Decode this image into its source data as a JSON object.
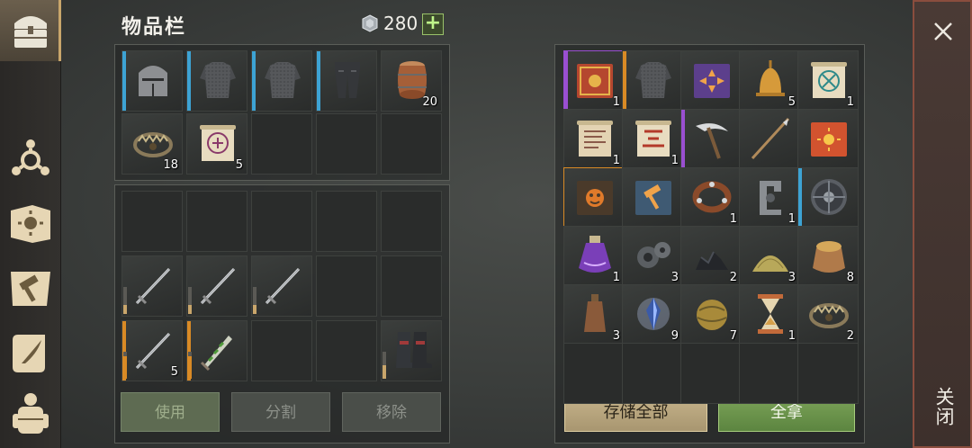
{
  "inventory": {
    "title": "物品栏",
    "currency_amount": "280",
    "add_label": "+",
    "rows": [
      [
        {
          "item": "knight-helmet",
          "rarity": "blue",
          "count": ""
        },
        {
          "item": "dark-chainmail-armor",
          "rarity": "blue",
          "count": ""
        },
        {
          "item": "dark-chainmail-armor",
          "rarity": "blue",
          "count": ""
        },
        {
          "item": "dark-leg-armor",
          "rarity": "blue",
          "count": ""
        },
        {
          "item": "wooden-barrel",
          "rarity": "",
          "count": "20"
        }
      ],
      [
        {
          "item": "bear-trap",
          "rarity": "",
          "count": "18"
        },
        {
          "item": "purple-rune-scroll",
          "rarity": "",
          "count": "5"
        },
        null,
        null,
        null
      ]
    ],
    "lower_rows": [
      [
        null,
        null,
        null,
        null,
        null
      ],
      [
        {
          "item": "steel-sword",
          "rarity": "",
          "count": "",
          "durability": 0.33,
          "dur_color": "#c9a66b"
        },
        {
          "item": "steel-sword",
          "rarity": "",
          "count": "",
          "durability": 0.33,
          "dur_color": "#c9a66b"
        },
        {
          "item": "steel-sword",
          "rarity": "",
          "count": "",
          "durability": 0.33,
          "dur_color": "#c9a66b"
        },
        null,
        null
      ],
      [
        {
          "item": "steel-sword",
          "rarity": "orange",
          "count": "5",
          "durability": 0.85,
          "dur_color": "#d98a25"
        },
        {
          "item": "green-spiral-dagger",
          "rarity": "orange",
          "count": "",
          "durability": 0.85,
          "dur_color": "#d98a25"
        },
        null,
        null,
        {
          "item": "dark-boots",
          "rarity": "",
          "count": "",
          "durability": 0.5,
          "dur_color": "#c9a66b"
        }
      ]
    ],
    "buttons": {
      "use": "使用",
      "split": "分割",
      "remove": "移除"
    }
  },
  "storage": {
    "rows": [
      [
        {
          "item": "red-spellbook",
          "rarity": "purple",
          "count": "1"
        },
        {
          "item": "dark-chainmail-armor",
          "rarity": "orange",
          "count": ""
        },
        {
          "item": "purple-arrow-book",
          "rarity": "",
          "count": ""
        },
        {
          "item": "golden-bell",
          "rarity": "",
          "count": "5"
        },
        {
          "item": "teal-rune-scroll",
          "rarity": "",
          "count": "1"
        }
      ],
      [
        {
          "item": "ancient-scroll",
          "rarity": "",
          "count": "1"
        },
        {
          "item": "red-rune-scroll",
          "rarity": "",
          "count": "1"
        },
        {
          "item": "scythe",
          "rarity": "purple-border",
          "count": ""
        },
        {
          "item": "long-spear",
          "rarity": "",
          "count": ""
        },
        {
          "item": "orange-sun-book",
          "rarity": "",
          "count": ""
        }
      ],
      [
        {
          "item": "brown-face-book",
          "rarity": "orange-border",
          "count": ""
        },
        {
          "item": "blue-hammer-book",
          "rarity": "",
          "count": ""
        },
        {
          "item": "leather-collar",
          "rarity": "",
          "count": "1"
        },
        {
          "item": "iron-clamp",
          "rarity": "",
          "count": "1"
        },
        {
          "item": "round-shield",
          "rarity": "blue",
          "count": ""
        }
      ],
      [
        {
          "item": "purple-potion",
          "rarity": "",
          "count": "1"
        },
        {
          "item": "gear-parts",
          "rarity": "",
          "count": "3"
        },
        {
          "item": "coal-pile",
          "rarity": "",
          "count": "2"
        },
        {
          "item": "sand-pile",
          "rarity": "",
          "count": "3"
        },
        {
          "item": "grain-sack",
          "rarity": "",
          "count": "8"
        }
      ],
      [
        {
          "item": "leather-flask",
          "rarity": "",
          "count": "3"
        },
        {
          "item": "lightning-crystal",
          "rarity": "",
          "count": "9"
        },
        {
          "item": "straw-ball",
          "rarity": "",
          "count": "7"
        },
        {
          "item": "hourglass",
          "rarity": "",
          "count": "1"
        },
        {
          "item": "bear-trap",
          "rarity": "",
          "count": "2"
        }
      ],
      [
        null,
        null,
        null,
        null,
        null
      ]
    ],
    "buttons": {
      "store_all": "存储全部",
      "take_all": "全拿"
    }
  },
  "close": {
    "label": "关闭"
  },
  "sidebar_icons": [
    "treasure-chest-icon",
    "triskelion-icon",
    "sun-book-icon",
    "hammer-map-icon",
    "quill-scroll-icon",
    "backpack-icon"
  ]
}
